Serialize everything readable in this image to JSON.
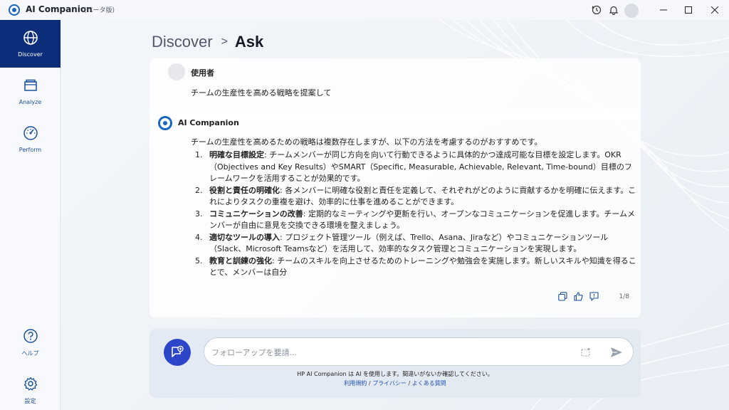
{
  "app": {
    "title": "AI Companion",
    "beta": "(ベータ版)"
  },
  "sidebar": {
    "items": [
      {
        "label": "Discover",
        "icon": "globe-icon",
        "active": true
      },
      {
        "label": "Analyze",
        "icon": "folder-icon",
        "active": false
      },
      {
        "label": "Perform",
        "icon": "speedometer-icon",
        "active": false
      },
      {
        "label": "ヘルプ",
        "icon": "help-icon",
        "active": false
      },
      {
        "label": "設定",
        "icon": "gear-icon",
        "active": false
      }
    ]
  },
  "breadcrumb": {
    "parent": "Discover",
    "separator": ">",
    "current": "Ask"
  },
  "user_message": {
    "name": "使用者",
    "text": "チームの生産性を高める戦略を提案して"
  },
  "ai_message": {
    "name": "AI Companion",
    "intro": "チームの生産性を高めるための戦略は複数存在しますが、以下の方法を考慮するのがおすすめです。",
    "items": [
      {
        "num": "1.",
        "title": "明確な目標設定",
        "lines": ": チームメンバーが同じ方向を向いて行動できるように具体的かつ達成可能な目標を設定します。OKR（Objectives and Key Results）やSMART（Specific, Measurable, Achievable, Relevant, Time-bound）目標のフレームワークを活用することが効果的です。"
      },
      {
        "num": "2.",
        "title": "役割と責任の明確化",
        "lines": ": 各メンバーに明確な役割と責任を定義して、それぞれがどのように貢献するかを明確に伝えます。これによりタスクの重複を避け、効率的に仕事を進めることができます。"
      },
      {
        "num": "3.",
        "title": "コミュニケーションの改善",
        "lines": ": 定期的なミーティングや更新を行い、オープンなコミュニケーションを促進します。チームメンバーが自由に意見を交換できる環境を整えましょう。"
      },
      {
        "num": "4.",
        "title": "適切なツールの導入",
        "lines": ": プロジェクト管理ツール（例えば、Trello、Asana、Jiraなど）やコミュニケーションツール（Slack、Microsoft Teamsなど）を活用して、効率的なタスク管理とコミュニケーションを実現します。"
      },
      {
        "num": "5.",
        "title": "教育と訓練の強化",
        "lines": ": チームのスキルを向上させるためのトレーニングや勉強会を実施します。新しいスキルや知識を得ることで、メンバーは自分"
      }
    ],
    "page_count": "1/8"
  },
  "chat": {
    "placeholder": "フォローアップを要請...",
    "disclaimer": "HP AI Companion は AI を使用します。間違いがないか確認してください。",
    "links": [
      "利用規約",
      "プライバシー",
      "よくある質問"
    ],
    "link_sep": " / "
  },
  "colors": {
    "active_nav": "#0b2d7a",
    "accent": "#2d46c9",
    "link": "#1b4fb3"
  }
}
